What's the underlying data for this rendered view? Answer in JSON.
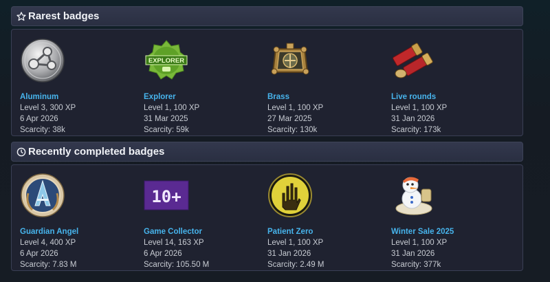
{
  "sections": [
    {
      "title": "Rarest badges",
      "icon": "star-outline-icon",
      "badges": [
        {
          "name": "Aluminum",
          "level": "Level 3, 300 XP",
          "date": "6 Apr 2026",
          "scarcity": "Scarcity: 38k",
          "icon": "aluminum-badge-icon"
        },
        {
          "name": "Explorer",
          "level": "Level 1, 100 XP",
          "date": "31 Mar 2025",
          "scarcity": "Scarcity: 59k",
          "icon": "explorer-badge-icon",
          "icon_text": "EXPLORER"
        },
        {
          "name": "Brass",
          "level": "Level 1, 100 XP",
          "date": "27 Mar 2025",
          "scarcity": "Scarcity: 130k",
          "icon": "brass-badge-icon"
        },
        {
          "name": "Live rounds",
          "level": "Level 1, 100 XP",
          "date": "31 Jan 2026",
          "scarcity": "Scarcity: 173k",
          "icon": "live-rounds-badge-icon"
        }
      ]
    },
    {
      "title": "Recently completed badges",
      "icon": "clock-icon",
      "badges": [
        {
          "name": "Guardian Angel",
          "level": "Level 4, 400 XP",
          "date": "6 Apr 2026",
          "scarcity": "Scarcity: 7.83 M",
          "icon": "guardian-angel-badge-icon"
        },
        {
          "name": "Game Collector",
          "level": "Level 14, 163 XP",
          "date": "6 Apr 2026",
          "scarcity": "Scarcity: 105.50 M",
          "icon": "game-collector-badge-icon",
          "icon_text": "10+"
        },
        {
          "name": "Patient Zero",
          "level": "Level 1, 100 XP",
          "date": "31 Jan 2026",
          "scarcity": "Scarcity: 2.49 M",
          "icon": "patient-zero-badge-icon"
        },
        {
          "name": "Winter Sale 2025",
          "level": "Level 1, 100 XP",
          "date": "31 Jan 2026",
          "scarcity": "Scarcity: 377k",
          "icon": "winter-sale-badge-icon"
        }
      ]
    }
  ],
  "colors": {
    "link": "#47b4ec",
    "panel": "#1f2230",
    "header": "#2d3245"
  }
}
